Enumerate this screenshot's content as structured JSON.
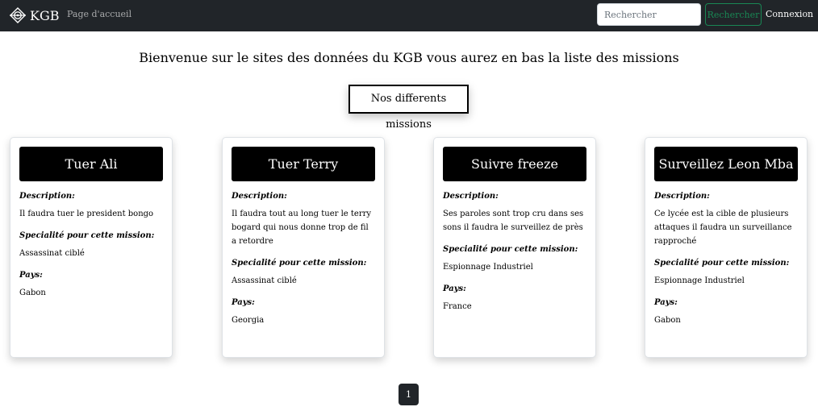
{
  "navbar": {
    "brand": "KGB",
    "home_link": "Page d'accueil",
    "search_placeholder": "Rechercher",
    "search_button": "Rechercher",
    "login_link": "Connexion",
    "background_color": "#212529",
    "accent_color": "#198754"
  },
  "main": {
    "welcome": "Bienvenue sur le sites des données du KGB vous aurez en bas la liste des missions",
    "section_title": "Nos differents missions"
  },
  "missions": [
    {
      "title": "Tuer Ali",
      "description_label": "Description:",
      "description": "Il faudra tuer le president bongo",
      "specialty_label": "Specialité pour cette mission:",
      "specialty": "Assassinat ciblé",
      "country_label": "Pays:",
      "country": "Gabon"
    },
    {
      "title": "Tuer Terry",
      "description_label": "Description:",
      "description": "Il faudra tout au long tuer le terry bogard qui nous donne trop de fil a retordre",
      "specialty_label": "Specialité pour cette mission:",
      "specialty": "Assassinat ciblé",
      "country_label": "Pays:",
      "country": "Georgia"
    },
    {
      "title": "Suivre freeze",
      "description_label": "Description:",
      "description": "Ses paroles sont trop cru dans ses sons il faudra le surveillez de près",
      "specialty_label": "Specialité pour cette mission:",
      "specialty": "Espionnage Industriel",
      "country_label": "Pays:",
      "country": "France"
    },
    {
      "title": "Surveillez Leon Mba",
      "description_label": "Description:",
      "description": "Ce lycée est la cible de plusieurs attaques il faudra un surveillance rapproché",
      "specialty_label": "Specialité pour cette mission:",
      "specialty": "Espionnage Industriel",
      "country_label": "Pays:",
      "country": "Gabon"
    }
  ],
  "pagination": {
    "current_page": "1"
  },
  "icons": {
    "brand_logo": "kgb-logo-icon"
  }
}
